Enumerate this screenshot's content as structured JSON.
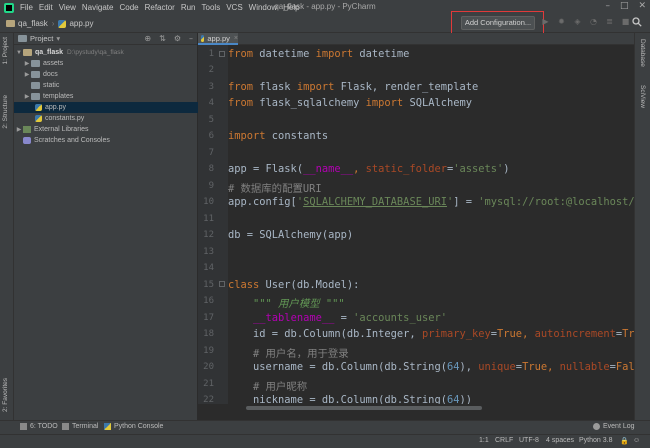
{
  "window_title": "qa_flask - app.py - PyCharm",
  "menu": [
    "File",
    "Edit",
    "View",
    "Navigate",
    "Code",
    "Refactor",
    "Run",
    "Tools",
    "VCS",
    "Window",
    "Help"
  ],
  "breadcrumb": [
    "qa_flask",
    "app.py"
  ],
  "run_config": "Add Configuration...",
  "project_panel": {
    "title": "Project",
    "tree": [
      {
        "label": "qa_flask",
        "hint": "D:\\pystudy\\qa_flask"
      },
      {
        "label": "assets"
      },
      {
        "label": "docs"
      },
      {
        "label": "static"
      },
      {
        "label": "templates"
      },
      {
        "label": "app.py"
      },
      {
        "label": "constants.py"
      },
      {
        "label": "External Libraries"
      },
      {
        "label": "Scratches and Consoles"
      }
    ]
  },
  "left_stripe": {
    "project": "1: Project",
    "structure": "2: Structure",
    "favorites": "2: Favorites"
  },
  "right_stripe": {
    "database": "Database",
    "sciview": "SciView"
  },
  "editor": {
    "tab": "app.py",
    "line_numbers": [
      "1",
      "2",
      "3",
      "4",
      "5",
      "6",
      "7",
      "8",
      "9",
      "10",
      "11",
      "12",
      "13",
      "14",
      "15",
      "16",
      "17",
      "18",
      "19",
      "20",
      "21",
      "22"
    ],
    "lines": {
      "l1": {
        "a": "from",
        "b": " datetime ",
        "c": "import",
        "d": " datetime"
      },
      "l3": {
        "a": "from",
        "b": " flask ",
        "c": "import",
        "d": " Flask, render_template"
      },
      "l4": {
        "a": "from",
        "b": " flask_sqlalchemy ",
        "c": "import",
        "d": " SQLAlchemy"
      },
      "l6": {
        "a": "import",
        "b": " constants"
      },
      "l8": {
        "a": "app = Flask(",
        "b": "__name__",
        "c": ", ",
        "d": "static_folder",
        "e": "=",
        "f": "'assets'",
        "g": ")"
      },
      "l9": {
        "a": "# 数据库的配置URI"
      },
      "l10": {
        "a": "app.config[",
        "b": "'",
        "c": "SQLALCHEMY_DATABASE_URI",
        "d": "'",
        "e": "] = ",
        "f": "'mysql://root:@localhost/flas"
      },
      "l12": {
        "a": "db = SQLAlchemy(app)"
      },
      "l15": {
        "a": "class",
        "b": " User(db.Model):"
      },
      "l16": {
        "a": "    \"\"\" 用户模型 \"\"\""
      },
      "l17": {
        "a": "    ",
        "b": "__tablename__",
        "c": " = ",
        "d": "'accounts_user'"
      },
      "l18": {
        "a": "    id = db.Column(db.Integer, ",
        "b": "primary_key",
        "c": "=",
        "d": "True",
        "e": ", ",
        "f": "autoincrement",
        "g": "=",
        "h": "True",
        "i": ")"
      },
      "l19": {
        "a": "    # 用户名，用于登录"
      },
      "l20": {
        "a": "    username = db.Column(db.String(",
        "b": "64",
        "c": "), ",
        "d": "unique",
        "e": "=",
        "f": "True",
        "g": ", ",
        "h": "nullable",
        "i": "=",
        "j": "False",
        "k": ")"
      },
      "l21": {
        "a": "    # 用户昵称"
      },
      "l22": {
        "a": "    nickname = db.Column(db.String(",
        "b": "64",
        "c": "))"
      }
    }
  },
  "bottom_tools": {
    "todo": "6: TODO",
    "terminal": "Terminal",
    "python_console": "Python Console",
    "event_log": "Event Log"
  },
  "status": {
    "position": "1:1",
    "line_sep": "CRLF",
    "encoding": "UTF-8",
    "indent": "4 spaces",
    "interpreter": "Python 3.8"
  }
}
